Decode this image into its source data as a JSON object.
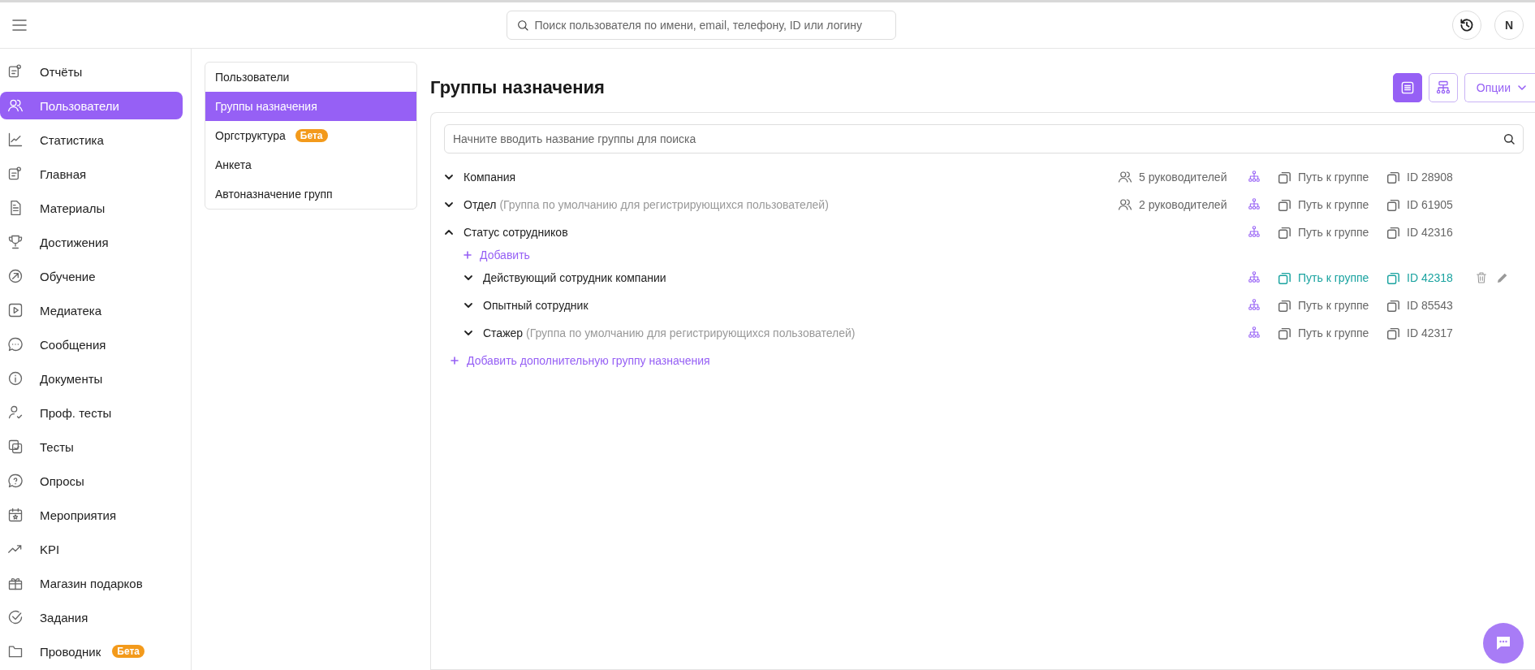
{
  "topbar": {
    "search": {
      "placeholder": "Поиск пользователя по имени, email, телефону, ID или логину"
    },
    "avatar": "N"
  },
  "sidebar": {
    "items": [
      {
        "label": "Отчёты",
        "selected": false
      },
      {
        "label": "Пользователи",
        "selected": true
      },
      {
        "label": "Статистика",
        "selected": false
      },
      {
        "label": "Главная",
        "selected": false
      },
      {
        "label": "Материалы",
        "selected": false
      },
      {
        "label": "Достижения",
        "selected": false
      },
      {
        "label": "Обучение",
        "selected": false
      },
      {
        "label": "Медиатека",
        "selected": false
      },
      {
        "label": "Сообщения",
        "selected": false
      },
      {
        "label": "Документы",
        "selected": false
      },
      {
        "label": "Проф. тесты",
        "selected": false
      },
      {
        "label": "Тесты",
        "selected": false
      },
      {
        "label": "Опросы",
        "selected": false
      },
      {
        "label": "Мероприятия",
        "selected": false
      },
      {
        "label": "KPI",
        "selected": false
      },
      {
        "label": "Магазин подарков",
        "selected": false
      },
      {
        "label": "Задания",
        "selected": false
      },
      {
        "label": "Проводник",
        "selected": false,
        "badge": "Бета"
      }
    ]
  },
  "subnav": {
    "items": [
      {
        "label": "Пользователи",
        "selected": false
      },
      {
        "label": "Группы назначения",
        "selected": true
      },
      {
        "label": "Оргструктура",
        "selected": false,
        "badge": "Бета"
      },
      {
        "label": "Анкета",
        "selected": false
      },
      {
        "label": "Автоназначение групп",
        "selected": false
      }
    ]
  },
  "page": {
    "title": "Группы назначения",
    "views": [
      {
        "kind": "list",
        "selected": true
      },
      {
        "kind": "tree",
        "selected": false
      }
    ],
    "options": "Опции"
  },
  "groups": {
    "search": {
      "placeholder": "Начните вводить название группы для поиска"
    },
    "rows": [
      {
        "name": "Компания",
        "expanded": false,
        "hovered": false,
        "managers": "5 руководителей",
        "path": "Путь к группе",
        "id": "ID 28908"
      },
      {
        "name": "Отдел",
        "note": "(Группа по умолчанию для регистрирующихся пользователей)",
        "expanded": false,
        "hovered": false,
        "managers": "2 руководителей",
        "path": "Путь к группе",
        "id": "ID 61905"
      },
      {
        "name": "Статус сотрудников",
        "expanded": true,
        "hovered": false,
        "path": "Путь к группе",
        "id": "ID 42316",
        "add": "Добавить",
        "children": [
          {
            "name": "Действующий сотрудник компании",
            "expanded": false,
            "hovered": true,
            "path": "Путь к группе",
            "id": "ID 42318"
          },
          {
            "name": "Опытный сотрудник",
            "expanded": false,
            "hovered": false,
            "path": "Путь к группе",
            "id": "ID 85543"
          },
          {
            "name": "Стажер",
            "note": "(Группа по умолчанию для регистрирующихся пользователей)",
            "expanded": false,
            "hovered": false,
            "path": "Путь к группе",
            "id": "ID 42317"
          }
        ]
      }
    ],
    "add_group": "Добавить дополнительную группу назначения"
  }
}
